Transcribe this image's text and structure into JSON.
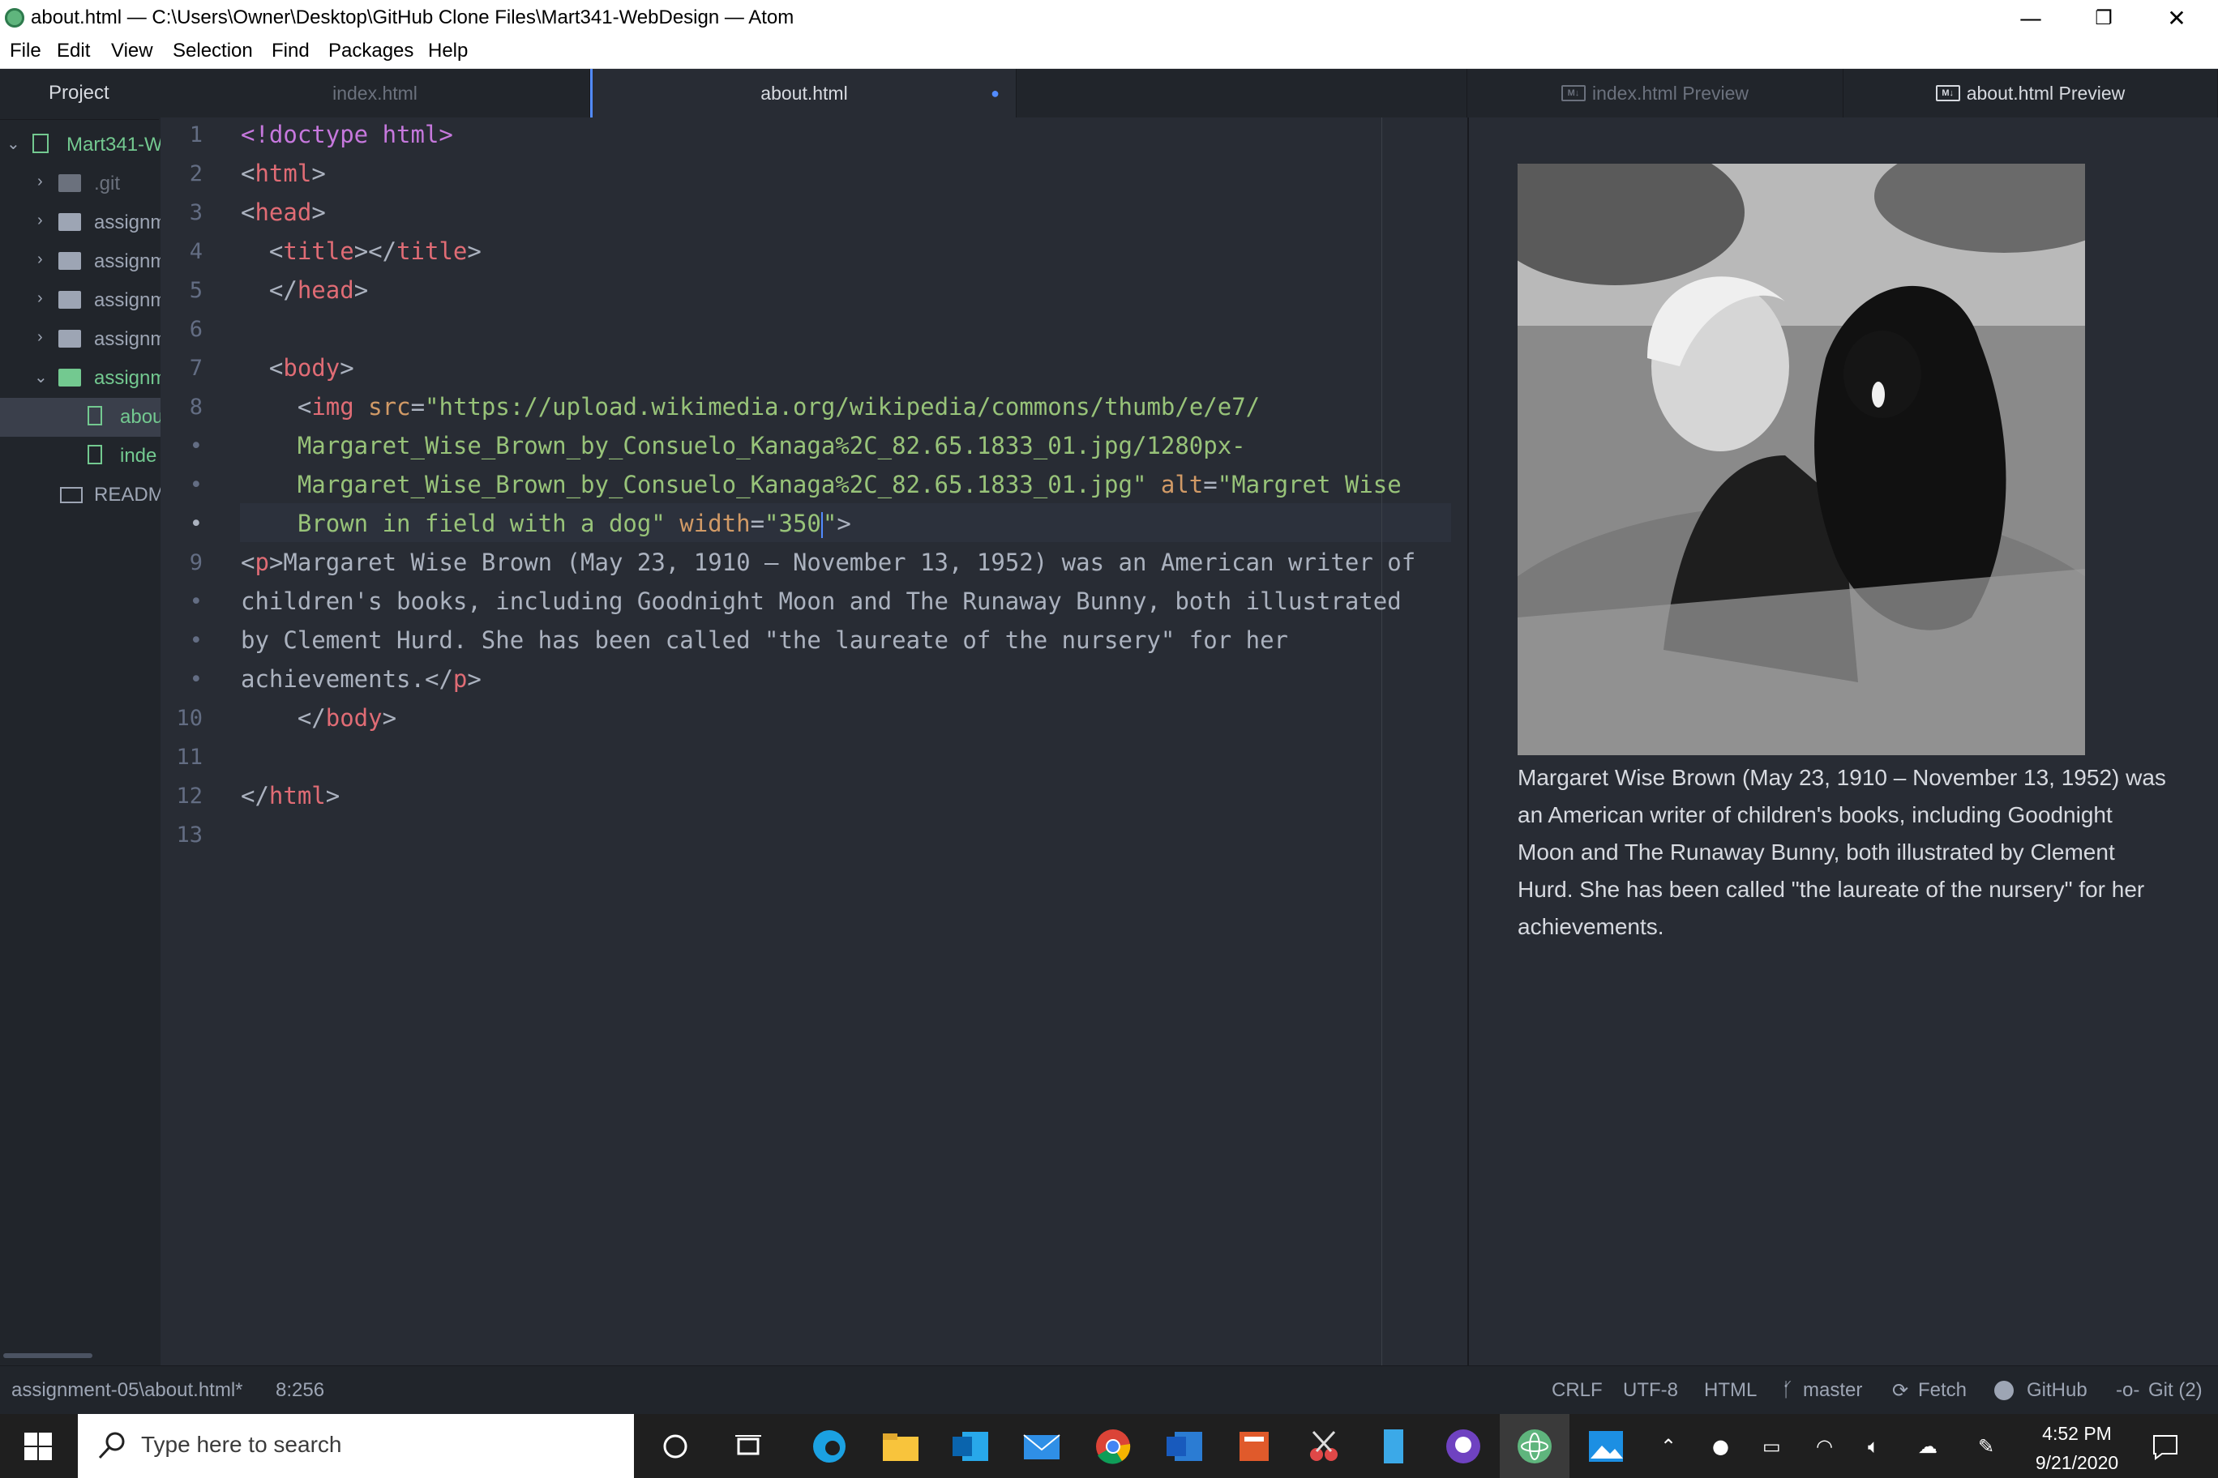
{
  "window": {
    "title": "about.html — C:\\Users\\Owner\\Desktop\\GitHub Clone Files\\Mart341-WebDesign — Atom",
    "minimize": "—",
    "maximize": "❐",
    "close": "✕"
  },
  "menu": [
    "File",
    "Edit",
    "View",
    "Selection",
    "Find",
    "Packages",
    "Help"
  ],
  "tree": {
    "header": "Project",
    "root": "Mart341-W",
    "items": [
      ".git",
      "assignm",
      "assignm",
      "assignm",
      "assignm",
      "assignm",
      "abou",
      "inde",
      "READM"
    ]
  },
  "tabs": [
    "index.html",
    "about.html",
    "index.html Preview",
    "about.html Preview"
  ],
  "tab_modified_dot": "●",
  "gutter": [
    "1",
    "2",
    "3",
    "4",
    "5",
    "6",
    "7",
    "8",
    "•",
    "•",
    "•",
    "9",
    "•",
    "•",
    "•",
    "10",
    "11",
    "12",
    "13"
  ],
  "code": {
    "l1": "<!doctype html>",
    "l2_tag": "html",
    "l3_tag": "head",
    "l4_open": "title",
    "l4_close": "title",
    "l5_tag": "head",
    "l7_tag": "body",
    "l8_tag": "img",
    "l8_attr_src": "src",
    "l8_src_1": "\"https://upload.wikimedia.org/wikipedia/commons/thumb/e/e7/",
    "l8_src_2": "Margaret_Wise_Brown_by_Consuelo_Kanaga%2C_82.65.1833_01.jpg/1280px-",
    "l8_src_3": "Margaret_Wise_Brown_by_Consuelo_Kanaga%2C_82.65.1833_01.jpg\"",
    "l8_attr_alt": "alt",
    "l8_alt_1": "\"Margret Wise",
    "l8_alt_2": "Brown in field with a dog\"",
    "l8_attr_width": "width",
    "l8_width_val_a": "\"350",
    "l8_width_val_b": "\"",
    "l9_tag": "p",
    "l9_text_1": "Margaret Wise Brown (May 23, 1910 – November 13, 1952) was an American writer of",
    "l9_text_2": "children's books, including Goodnight Moon and The Runaway Bunny, both illustrated",
    "l9_text_3": "by Clement Hurd. She has been called \"the laureate of the nursery\" for her",
    "l9_text_4": "achievements.",
    "l10_tag": "body",
    "l12_tag": "html"
  },
  "preview": {
    "text": "Margaret Wise Brown (May 23, 1910 – November 13, 1952) was an American writer of children's books, including Goodnight Moon and The Runaway Bunny, both illustrated by Clement Hurd. She has been called \"the laureate of the nursery\" for her achievements."
  },
  "status": {
    "file": "assignment-05\\about.html*",
    "cursor": "8:256",
    "line_ending": "CRLF",
    "encoding": "UTF-8",
    "grammar": "HTML",
    "branch": "master",
    "fetch": "Fetch",
    "github": "GitHub",
    "git": "Git (2)"
  },
  "taskbar": {
    "search_placeholder": "Type here to search",
    "time": "4:52 PM",
    "date": "9/21/2020"
  },
  "colors": {
    "editor_bg": "#282c34",
    "tag": "#e06c75",
    "attr": "#d19a66",
    "string": "#98c379",
    "accent": "#528bff",
    "git_added": "#73c990"
  }
}
